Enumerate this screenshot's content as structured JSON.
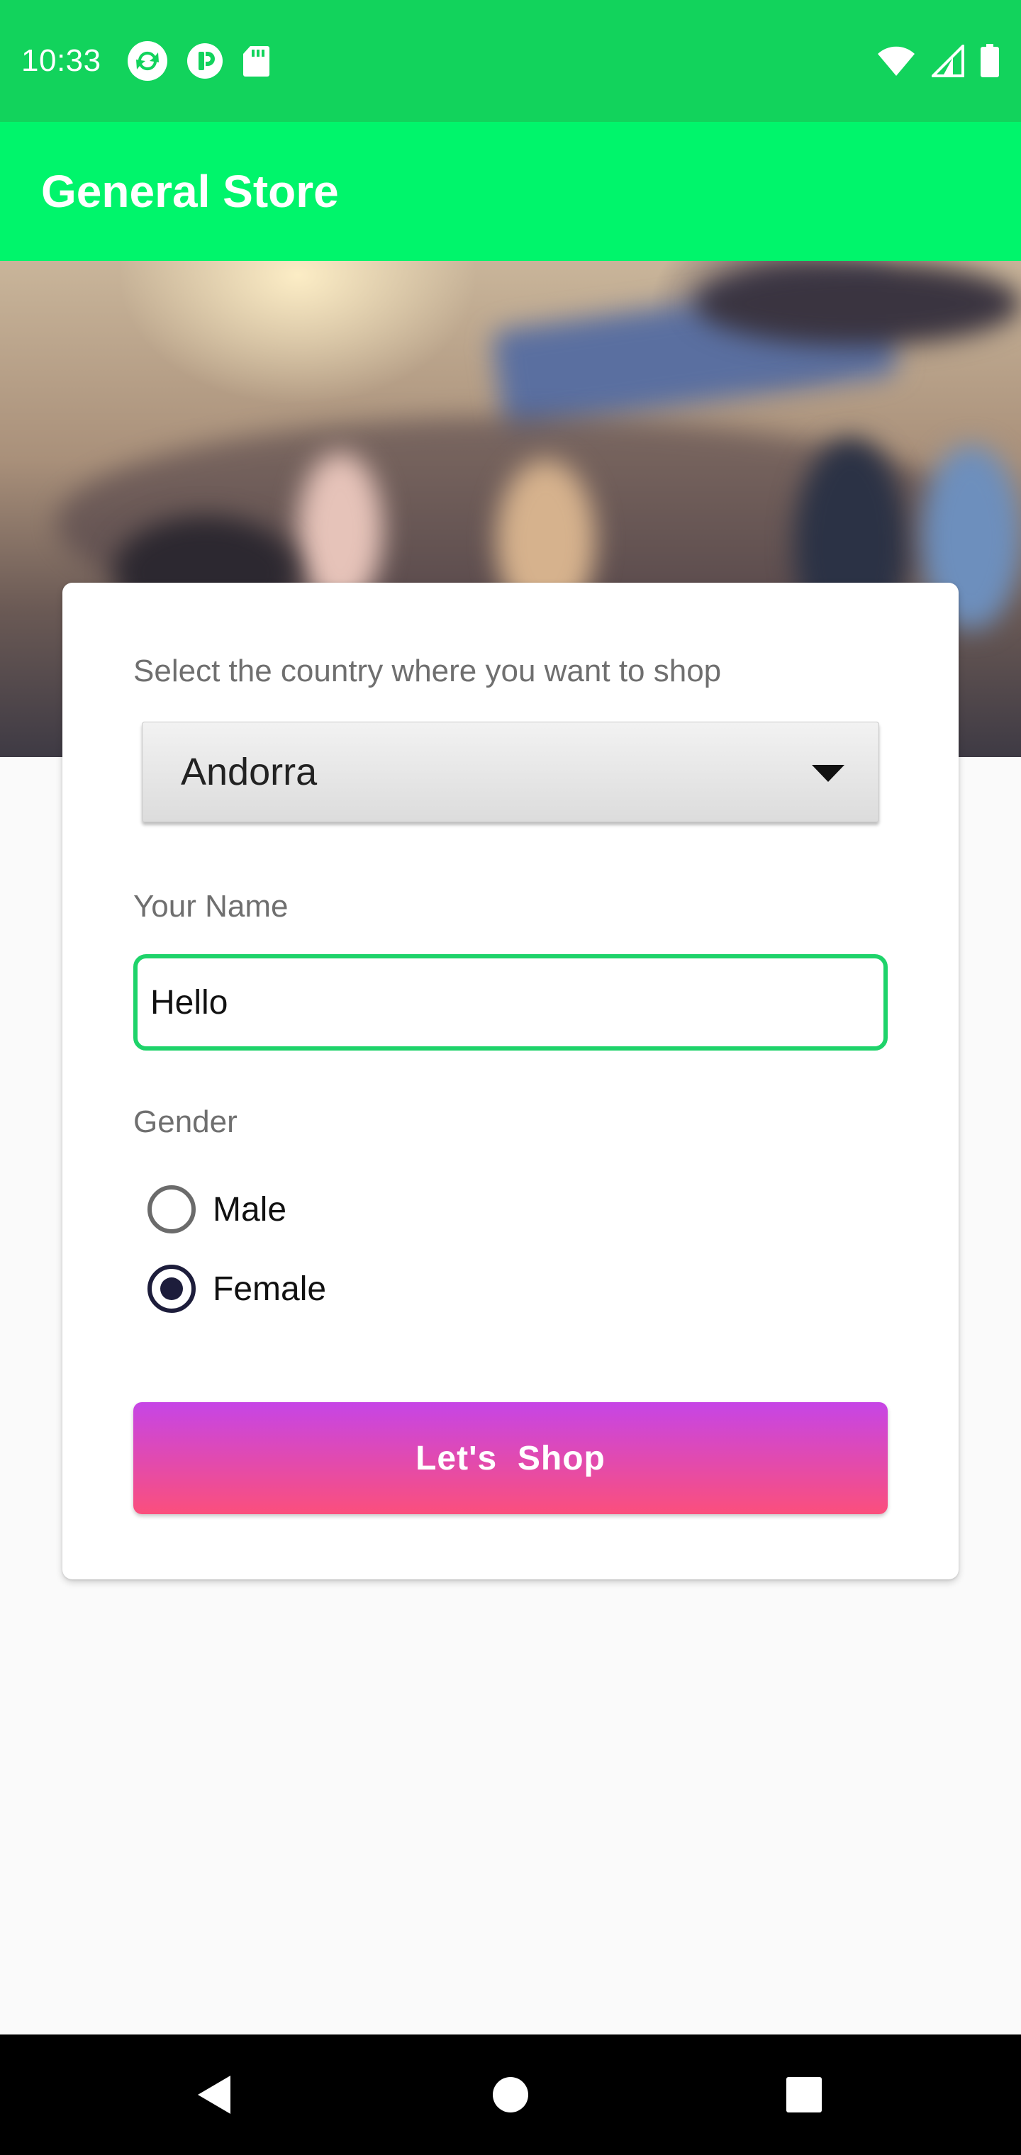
{
  "status_bar": {
    "time": "10:33",
    "notification_icons": [
      "sync-app-icon",
      "pocket-casts-icon",
      "sd-card-icon"
    ],
    "system_icons": [
      "wifi-icon",
      "cellular-signal-icon",
      "battery-icon"
    ]
  },
  "app_bar": {
    "title": "General Store"
  },
  "form": {
    "country_label": "Select the country where you want to shop",
    "country_value": "Andorra",
    "name_label": "Your Name",
    "name_value": "Hello",
    "gender_label": "Gender",
    "gender_options": [
      {
        "label": "Male",
        "selected": false
      },
      {
        "label": "Female",
        "selected": true
      }
    ],
    "submit_label": "Let's  Shop"
  },
  "colors": {
    "status_bar": "#12d35c",
    "app_bar": "#00f56b",
    "input_border": "#1ed36a",
    "button_gradient_top": "#c645e6",
    "button_gradient_bottom": "#fb4f7c",
    "radio_selected": "#1d1d3b"
  },
  "nav_bar": {
    "buttons": [
      "back-icon",
      "home-icon",
      "recents-icon"
    ]
  }
}
